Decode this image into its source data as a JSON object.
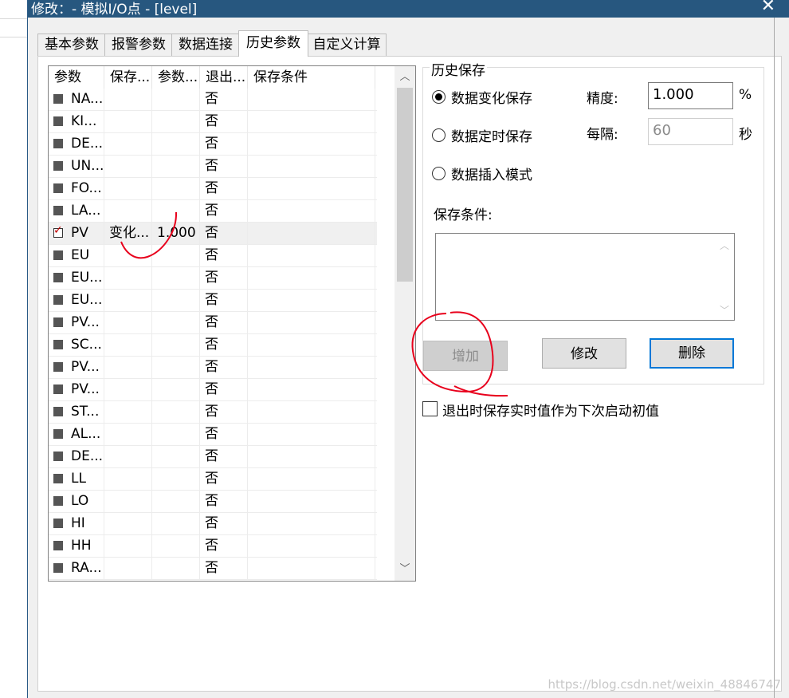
{
  "window": {
    "title": "修改：- 模拟I/O点 - [level]",
    "close_glyph": "✕"
  },
  "tabs": [
    "基本参数",
    "报警参数",
    "数据连接",
    "历史参数",
    "自定义计算"
  ],
  "active_tab": 3,
  "list": {
    "columns": [
      "参数",
      "保存...",
      "参数...",
      "退出...",
      "保存条件"
    ],
    "rows": [
      {
        "param": "NA...",
        "save": "",
        "value": "",
        "exit": "否",
        "cond": "",
        "checked": false
      },
      {
        "param": "KI...",
        "save": "",
        "value": "",
        "exit": "否",
        "cond": "",
        "checked": false
      },
      {
        "param": "DE...",
        "save": "",
        "value": "",
        "exit": "否",
        "cond": "",
        "checked": false
      },
      {
        "param": "UN...",
        "save": "",
        "value": "",
        "exit": "否",
        "cond": "",
        "checked": false
      },
      {
        "param": "FO...",
        "save": "",
        "value": "",
        "exit": "否",
        "cond": "",
        "checked": false
      },
      {
        "param": "LA...",
        "save": "",
        "value": "",
        "exit": "否",
        "cond": "",
        "checked": false
      },
      {
        "param": "PV",
        "save": "变化...",
        "value": "1.000",
        "exit": "否",
        "cond": "",
        "checked": true
      },
      {
        "param": "EU",
        "save": "",
        "value": "",
        "exit": "否",
        "cond": "",
        "checked": false
      },
      {
        "param": "EU...",
        "save": "",
        "value": "",
        "exit": "否",
        "cond": "",
        "checked": false
      },
      {
        "param": "EU...",
        "save": "",
        "value": "",
        "exit": "否",
        "cond": "",
        "checked": false
      },
      {
        "param": "PV...",
        "save": "",
        "value": "",
        "exit": "否",
        "cond": "",
        "checked": false
      },
      {
        "param": "SC...",
        "save": "",
        "value": "",
        "exit": "否",
        "cond": "",
        "checked": false
      },
      {
        "param": "PV...",
        "save": "",
        "value": "",
        "exit": "否",
        "cond": "",
        "checked": false
      },
      {
        "param": "PV...",
        "save": "",
        "value": "",
        "exit": "否",
        "cond": "",
        "checked": false
      },
      {
        "param": "ST...",
        "save": "",
        "value": "",
        "exit": "否",
        "cond": "",
        "checked": false
      },
      {
        "param": "AL...",
        "save": "",
        "value": "",
        "exit": "否",
        "cond": "",
        "checked": false
      },
      {
        "param": "DE...",
        "save": "",
        "value": "",
        "exit": "否",
        "cond": "",
        "checked": false
      },
      {
        "param": "LL",
        "save": "",
        "value": "",
        "exit": "否",
        "cond": "",
        "checked": false
      },
      {
        "param": "LO",
        "save": "",
        "value": "",
        "exit": "否",
        "cond": "",
        "checked": false
      },
      {
        "param": "HI",
        "save": "",
        "value": "",
        "exit": "否",
        "cond": "",
        "checked": false
      },
      {
        "param": "HH",
        "save": "",
        "value": "",
        "exit": "否",
        "cond": "",
        "checked": false
      },
      {
        "param": "RA...",
        "save": "",
        "value": "",
        "exit": "否",
        "cond": "",
        "checked": false
      }
    ],
    "selected_row": 6
  },
  "history": {
    "group_label": "历史保存",
    "radio_change": "数据变化保存",
    "radio_timed": "数据定时保存",
    "radio_insert": "数据插入模式",
    "selected_mode": "数据变化保存",
    "precision_label": "精度:",
    "precision_value": "1.000",
    "precision_unit": "%",
    "interval_label": "每隔:",
    "interval_value": "60",
    "interval_unit": "秒",
    "condition_label": "保存条件:",
    "condition_value": ""
  },
  "buttons": {
    "add": "增加",
    "modify": "修改",
    "delete": "删除"
  },
  "exit_checkbox_label": "退出时保存实时值作为下次启动初值",
  "exit_checkbox_checked": false,
  "watermark": "https://blog.csdn.net/weixin_48846747",
  "colors": {
    "titlebar": "#27577f",
    "annotation": "#e8001c",
    "default_button_border": "#0078d7"
  }
}
